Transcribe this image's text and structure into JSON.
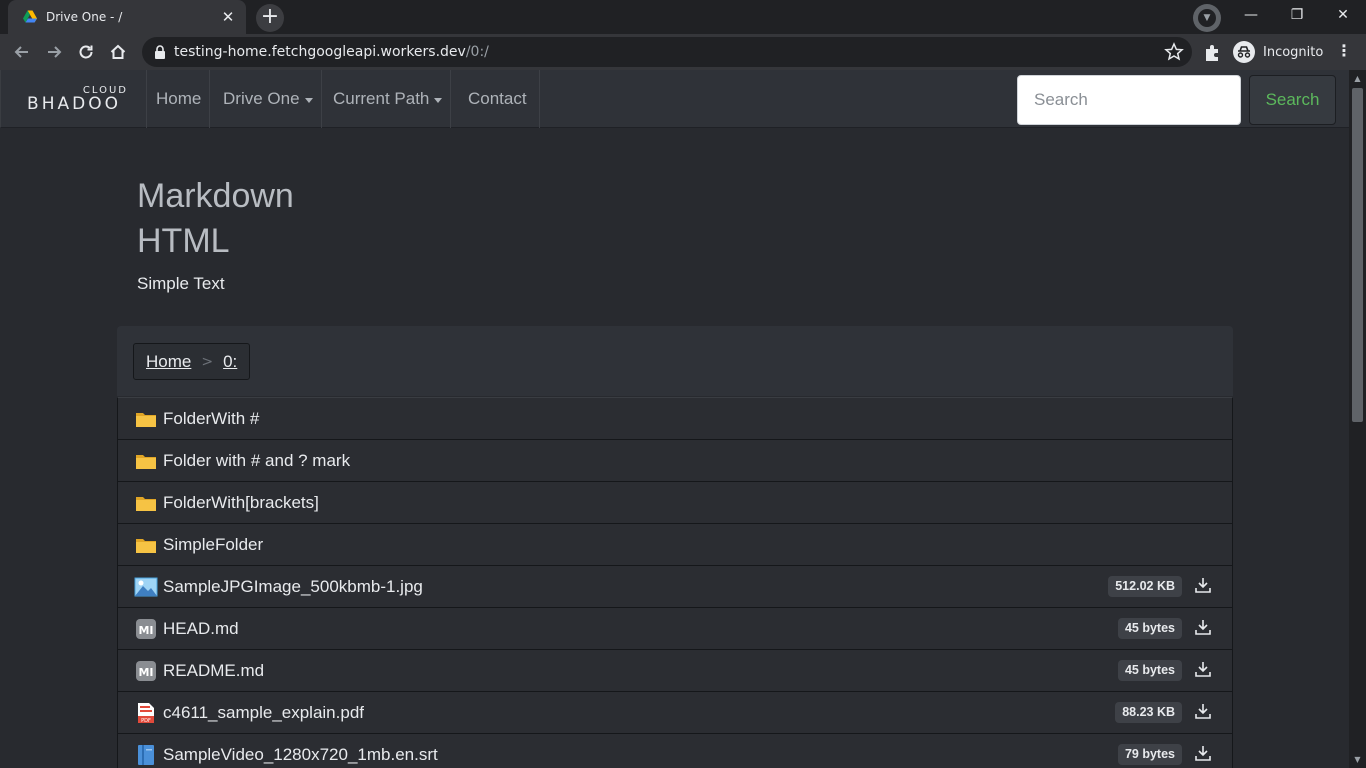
{
  "browser": {
    "tab_title": "Drive One - /",
    "url_host": "testing-home.fetchgoogleapi.workers.dev",
    "url_path": "/0:/",
    "incognito_label": "Incognito"
  },
  "navbar": {
    "brand_top": "CLOUD",
    "brand_main": "BHADOO",
    "links": {
      "home": "Home",
      "drive_one": "Drive One",
      "current_path": "Current Path",
      "contact": "Contact"
    },
    "search_placeholder": "Search",
    "search_button": "Search"
  },
  "readme": {
    "heading_1": "Markdown",
    "heading_2": "HTML",
    "paragraph": "Simple Text"
  },
  "breadcrumb": {
    "home": "Home",
    "separator": ">",
    "current": "0:"
  },
  "files": [
    {
      "name": "FolderWith #",
      "type": "folder",
      "size": ""
    },
    {
      "name": "Folder with # and ? mark",
      "type": "folder",
      "size": ""
    },
    {
      "name": "FolderWith[brackets]",
      "type": "folder",
      "size": ""
    },
    {
      "name": "SimpleFolder",
      "type": "folder",
      "size": ""
    },
    {
      "name": "SampleJPGImage_500kbmb-1.jpg",
      "type": "image",
      "size": "512.02 KB"
    },
    {
      "name": "HEAD.md",
      "type": "markdown",
      "size": "45 bytes"
    },
    {
      "name": "README.md",
      "type": "markdown",
      "size": "45 bytes"
    },
    {
      "name": "c4611_sample_explain.pdf",
      "type": "pdf",
      "size": "88.23 KB"
    },
    {
      "name": "SampleVideo_1280x720_1mb.en.srt",
      "type": "subtitle",
      "size": "79 bytes"
    }
  ],
  "colors": {
    "folder": "#f6c344",
    "search_button_text": "#5cb85c",
    "page_bg": "#282a2f"
  }
}
